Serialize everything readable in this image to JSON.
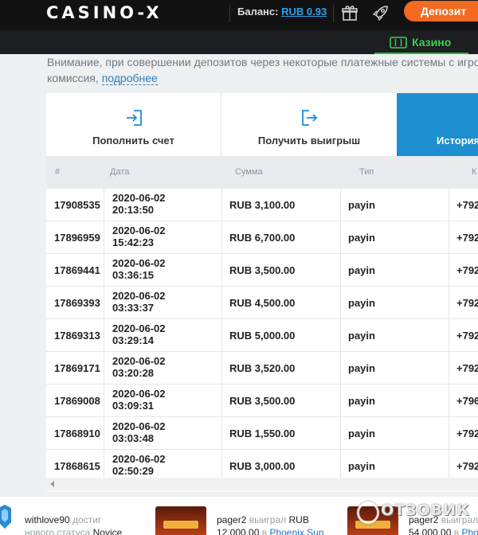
{
  "header": {
    "logo": "CASINO-X",
    "balance_label": "Баланс:",
    "balance_value": "RUB 0.93",
    "deposit_label": "Депозит",
    "casino_label": "Казино"
  },
  "notice": {
    "line1": "Внимание, при совершении депозитов через некоторые платежные системы с игро",
    "line2": "комиссия,",
    "more": "подробнее"
  },
  "tabs": [
    {
      "label": "Пополнить счет"
    },
    {
      "label": "Получить выигрыш"
    },
    {
      "label": "История"
    }
  ],
  "table": {
    "headers": [
      "#",
      "Дата",
      "Сумма",
      "Тип",
      "К"
    ],
    "rows": [
      {
        "id": "17908535",
        "date": "2020-06-02",
        "time": "20:13:50",
        "sum": "RUB 3,100.00",
        "type": "payin",
        "last": "+792"
      },
      {
        "id": "17896959",
        "date": "2020-06-02",
        "time": "15:42:23",
        "sum": "RUB 6,700.00",
        "type": "payin",
        "last": "+792"
      },
      {
        "id": "17869441",
        "date": "2020-06-02",
        "time": "03:36:15",
        "sum": "RUB 3,500.00",
        "type": "payin",
        "last": "+792"
      },
      {
        "id": "17869393",
        "date": "2020-06-02",
        "time": "03:33:37",
        "sum": "RUB 4,500.00",
        "type": "payin",
        "last": "+792"
      },
      {
        "id": "17869313",
        "date": "2020-06-02",
        "time": "03:29:14",
        "sum": "RUB 5,000.00",
        "type": "payin",
        "last": "+792"
      },
      {
        "id": "17869171",
        "date": "2020-06-02",
        "time": "03:20:28",
        "sum": "RUB 3,520.00",
        "type": "payin",
        "last": "+792"
      },
      {
        "id": "17869008",
        "date": "2020-06-02",
        "time": "03:09:31",
        "sum": "RUB 3,500.00",
        "type": "payin",
        "last": "+796"
      },
      {
        "id": "17868910",
        "date": "2020-06-02",
        "time": "03:03:48",
        "sum": "RUB 1,550.00",
        "type": "payin",
        "last": "+792"
      },
      {
        "id": "17868615",
        "date": "2020-06-02",
        "time": "02:50:29",
        "sum": "RUB 3,000.00",
        "type": "payin",
        "last": "+792"
      }
    ]
  },
  "feed": {
    "item1": {
      "user": "withlove90",
      "action": "достиг",
      "line2": "нового статуса",
      "status": "Novice"
    },
    "item2": {
      "user": "pager2",
      "action": "выиграл",
      "currency": "RUB",
      "amount": "12,000.00",
      "prep": "в",
      "game": "Phoenix Sun"
    },
    "item3": {
      "user": "pager2",
      "action": "выиграл",
      "amount": "54,000.00",
      "prep": "в",
      "game": "Phoe"
    }
  },
  "watermark": "ОТЗОВИК",
  "colors": {
    "accent": "#1d8fd0",
    "deposit": "#f36a21",
    "casino_green": "#3bd14b",
    "balance": "#2fa1ea"
  }
}
